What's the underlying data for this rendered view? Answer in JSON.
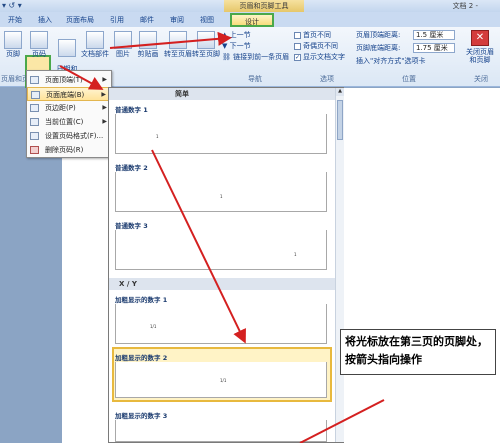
{
  "title_bar": {
    "context_group": "页眉和页脚工具",
    "document_title": "文档 2 - ",
    "qat": "▾ ↺ ▾"
  },
  "tabs": [
    "开始",
    "插入",
    "页面布局",
    "引用",
    "邮件",
    "审阅",
    "视图",
    "设计"
  ],
  "ribbon": {
    "buttons": {
      "footer": "页脚",
      "page_number": "页码",
      "date_time": "日期和\n时间",
      "doc_parts": "文档部件",
      "picture": "图片",
      "clipart": "剪贴画",
      "goto_header": "转至页眉",
      "goto_footer": "转至页脚",
      "prev_section": "上一节",
      "next_section": "下一节",
      "link_prev": "链接到前一条页眉",
      "close": "关闭页眉\n和页脚"
    },
    "options": {
      "first_page_diff": "首页不同",
      "odd_even_diff": "奇偶页不同",
      "show_doc_text": "显示文档文字"
    },
    "position": {
      "header_dist_label": "页眉顶端距离:",
      "header_dist_value": "1.5 厘米",
      "footer_dist_label": "页脚底端距离:",
      "footer_dist_value": "1.75 厘米",
      "insert_align_tab": "插入\"对齐方式\"选项卡"
    },
    "group_labels": {
      "header_footer": "页眉和页",
      "nav": "导航",
      "options": "选项",
      "position": "位置",
      "close": "关闭"
    }
  },
  "page_number_menu": [
    {
      "label": "页面顶端(T)",
      "submenu": true
    },
    {
      "label": "页面底端(B)",
      "submenu": true
    },
    {
      "label": "页边距(P)",
      "submenu": true
    },
    {
      "label": "当前位置(C)",
      "submenu": true
    },
    {
      "label": "设置页码格式(F)...",
      "submenu": false
    },
    {
      "label": "删除页码(R)",
      "submenu": false
    }
  ],
  "gallery": {
    "sections": [
      {
        "header": "简单",
        "items": [
          "普通数字 1",
          "普通数字 2",
          "普通数字 3"
        ]
      },
      {
        "header": "X / Y",
        "items": [
          "加粗显示的数字 1",
          "加粗显示的数字 2",
          "加粗显示的数字 3"
        ]
      }
    ],
    "item_numbers": [
      "1",
      "1",
      "1",
      "1/1",
      "1/1"
    ]
  },
  "annotation": "将光标放在第三页的页脚处，按箭头指向操作"
}
